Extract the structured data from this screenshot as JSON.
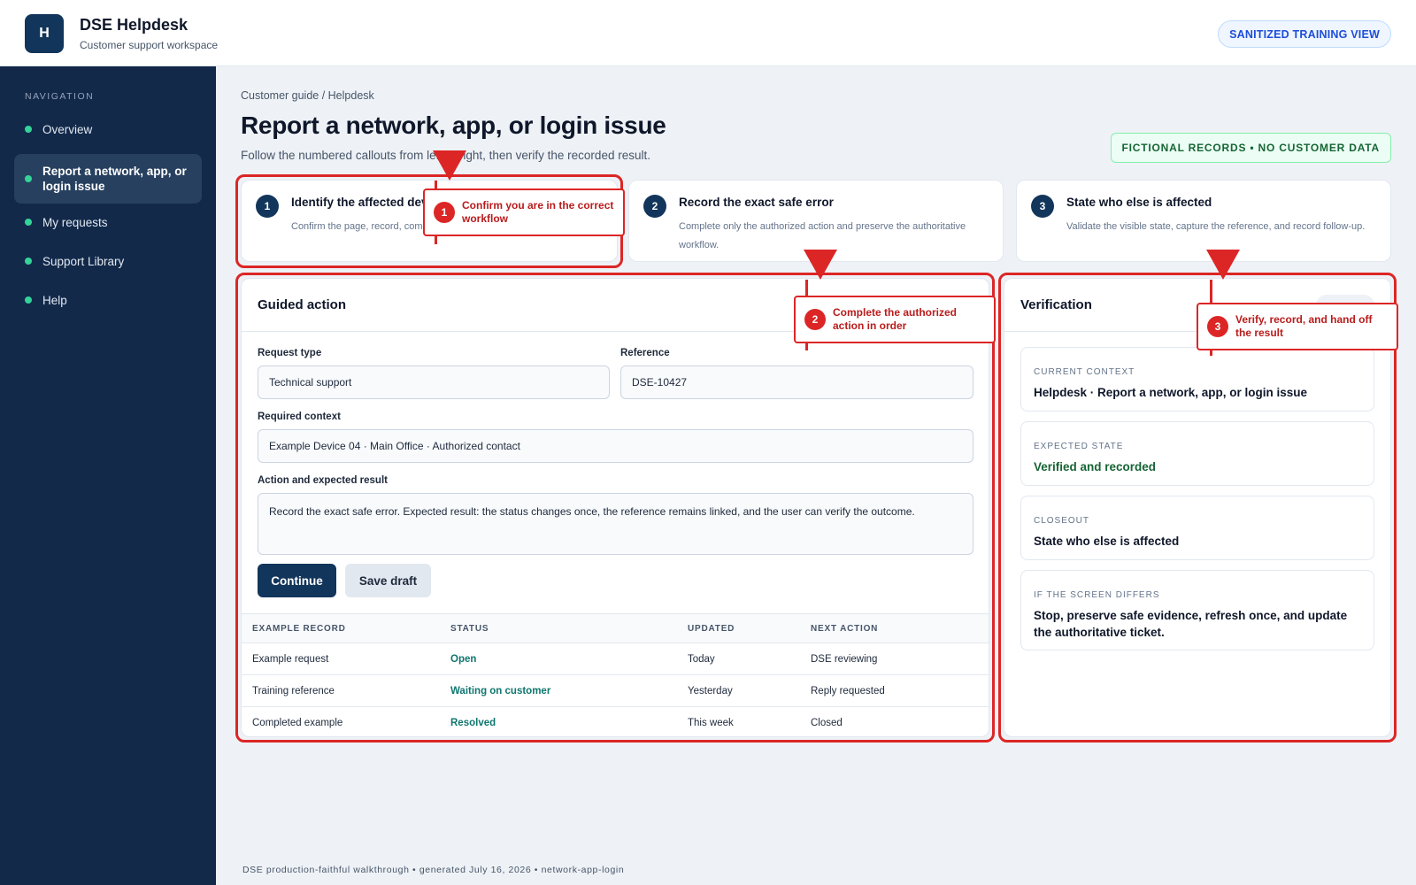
{
  "header": {
    "logo_letter": "H",
    "app_title": "DSE Helpdesk",
    "app_subtitle": "Customer support workspace",
    "training_badge": "SANITIZED TRAINING VIEW"
  },
  "sidebar": {
    "section_label": "NAVIGATION",
    "items": [
      {
        "label": "Overview"
      },
      {
        "label": "Report a network, app, or login issue",
        "active": true
      },
      {
        "label": "My requests"
      },
      {
        "label": "Support Library"
      },
      {
        "label": "Help"
      }
    ]
  },
  "main": {
    "breadcrumb": "Customer guide / Helpdesk",
    "title": "Report a network, app, or login issue",
    "subtitle": "Follow the numbered callouts from left to right, then verify the recorded result.",
    "fictional_badge": "FICTIONAL RECORDS • NO CUSTOMER DATA",
    "steps": [
      {
        "number": "1",
        "title": "Identify the affected device",
        "desc": "Confirm the page, record, communication method, and reference."
      },
      {
        "number": "2",
        "title": "Record the exact safe error",
        "desc": "Complete only the authorized action and preserve the authoritative workflow."
      },
      {
        "number": "3",
        "title": "State who else is affected",
        "desc": "Validate the visible state, capture the reference, and record follow-up."
      }
    ]
  },
  "guided_action": {
    "title": "Guided action",
    "request_type_label": "Request type",
    "request_type_value": "Technical support",
    "reference_label": "Reference",
    "reference_value": "DSE-10427",
    "context_label": "Required context",
    "context_value": "Example Device 04 · Main Office · Authorized contact",
    "action_label": "Action and expected result",
    "action_value": "Record the exact safe error. Expected result: the status changes once, the reference remains linked, and the user can verify the outcome.",
    "continue_label": "Continue",
    "save_draft_label": "Save draft",
    "table": {
      "headers": [
        "EXAMPLE RECORD",
        "STATUS",
        "UPDATED",
        "NEXT ACTION"
      ],
      "rows": [
        [
          "Example request",
          "Open",
          "Today",
          "DSE reviewing"
        ],
        [
          "Training reference",
          "Waiting on customer",
          "Yesterday",
          "Reply requested"
        ],
        [
          "Completed example",
          "Resolved",
          "This week",
          "Closed"
        ]
      ]
    }
  },
  "verification": {
    "title": "Verification",
    "cards": [
      {
        "label": "CURRENT CONTEXT",
        "value": "Helpdesk · Report a network, app, or login issue"
      },
      {
        "label": "EXPECTED STATE",
        "value": "Verified and recorded"
      },
      {
        "label": "CLOSEOUT",
        "value": "State who else is affected"
      },
      {
        "label": "IF THE SCREEN DIFFERS",
        "value": "Stop, preserve safe evidence, refresh once, and update the authoritative ticket."
      }
    ]
  },
  "callouts": [
    {
      "number": "1",
      "text": "Confirm you are in the correct workflow"
    },
    {
      "number": "2",
      "text": "Complete the authorized action in order"
    },
    {
      "number": "3",
      "text": "Verify, record, and hand off the result"
    }
  ],
  "colors": {
    "brand_navy": "#12355b",
    "sidebar": "#12294a",
    "annotation_red": "#dc2626",
    "status_teal": "#0f766e"
  },
  "footer": "DSE production-faithful walkthrough • generated July 16, 2026 • network-app-login"
}
